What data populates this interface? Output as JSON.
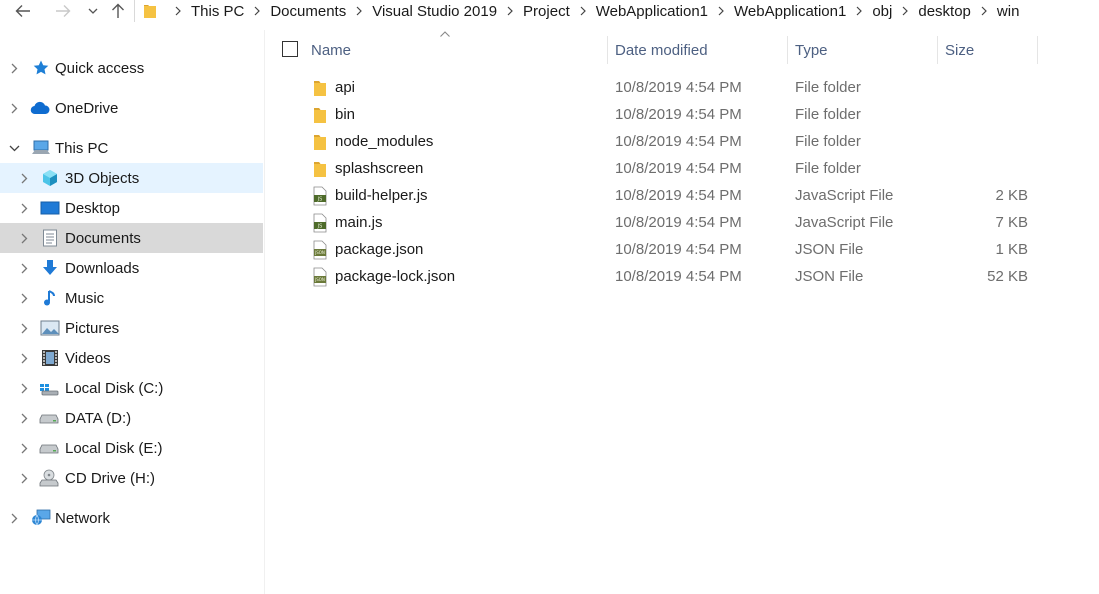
{
  "breadcrumbs": [
    "This PC",
    "Documents",
    "Visual Studio 2019",
    "Project",
    "WebApplication1",
    "WebApplication1",
    "obj",
    "desktop",
    "win"
  ],
  "nav": {
    "items": [
      {
        "label": "Quick access",
        "icon": "star-icon"
      },
      {
        "label": "OneDrive",
        "icon": "cloud-icon"
      },
      {
        "label": "This PC",
        "icon": "computer-icon"
      },
      {
        "label": "3D Objects",
        "icon": "cube-icon"
      },
      {
        "label": "Desktop",
        "icon": "desktop-icon"
      },
      {
        "label": "Documents",
        "icon": "documents-icon"
      },
      {
        "label": "Downloads",
        "icon": "download-icon"
      },
      {
        "label": "Music",
        "icon": "music-icon"
      },
      {
        "label": "Pictures",
        "icon": "pictures-icon"
      },
      {
        "label": "Videos",
        "icon": "videos-icon"
      },
      {
        "label": "Local Disk (C:)",
        "icon": "windows-drive-icon"
      },
      {
        "label": "DATA (D:)",
        "icon": "drive-icon"
      },
      {
        "label": "Local Disk (E:)",
        "icon": "drive-icon"
      },
      {
        "label": "CD Drive (H:)",
        "icon": "cd-drive-icon"
      },
      {
        "label": "Network",
        "icon": "network-icon"
      }
    ]
  },
  "columns": {
    "name": "Name",
    "date": "Date modified",
    "type": "Type",
    "size": "Size"
  },
  "files": [
    {
      "name": "api",
      "date": "10/8/2019 4:54 PM",
      "type": "File folder",
      "size": "",
      "icon": "folder-icon"
    },
    {
      "name": "bin",
      "date": "10/8/2019 4:54 PM",
      "type": "File folder",
      "size": "",
      "icon": "folder-icon"
    },
    {
      "name": "node_modules",
      "date": "10/8/2019 4:54 PM",
      "type": "File folder",
      "size": "",
      "icon": "folder-icon"
    },
    {
      "name": "splashscreen",
      "date": "10/8/2019 4:54 PM",
      "type": "File folder",
      "size": "",
      "icon": "folder-icon"
    },
    {
      "name": "build-helper.js",
      "date": "10/8/2019 4:54 PM",
      "type": "JavaScript File",
      "size": "2 KB",
      "icon": "js-file-icon"
    },
    {
      "name": "main.js",
      "date": "10/8/2019 4:54 PM",
      "type": "JavaScript File",
      "size": "7 KB",
      "icon": "js-file-icon"
    },
    {
      "name": "package.json",
      "date": "10/8/2019 4:54 PM",
      "type": "JSON File",
      "size": "1 KB",
      "icon": "json-file-icon"
    },
    {
      "name": "package-lock.json",
      "date": "10/8/2019 4:54 PM",
      "type": "JSON File",
      "size": "52 KB",
      "icon": "json-file-icon"
    }
  ],
  "icon_text": {
    "js": "JS",
    "json": "JSON"
  },
  "colors": {
    "hover": "#e5f3ff",
    "selected": "#d9d9d9",
    "folder": "#f5c242",
    "header_text": "#4d6082"
  }
}
